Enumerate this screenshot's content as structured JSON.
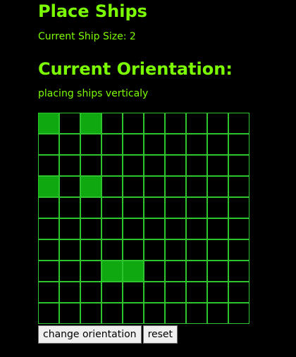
{
  "header": {
    "title": "Place Ships",
    "ship_size_text": "Current Ship Size: 2"
  },
  "orientation": {
    "heading": "Current Orientation:",
    "status": "placing ships verticaly"
  },
  "board": {
    "rows": 10,
    "cols": 10,
    "placed_cells": [
      [
        0,
        0
      ],
      [
        0,
        2
      ],
      [
        3,
        0
      ],
      [
        3,
        2
      ],
      [
        7,
        3
      ],
      [
        7,
        4
      ]
    ]
  },
  "controls": {
    "change_orientation_label": "change orientation",
    "reset_label": "reset"
  },
  "colors": {
    "text": "#7cfc00",
    "grid_line": "#2ec42e",
    "ship_fill": "#10a810",
    "background": "#000000"
  }
}
